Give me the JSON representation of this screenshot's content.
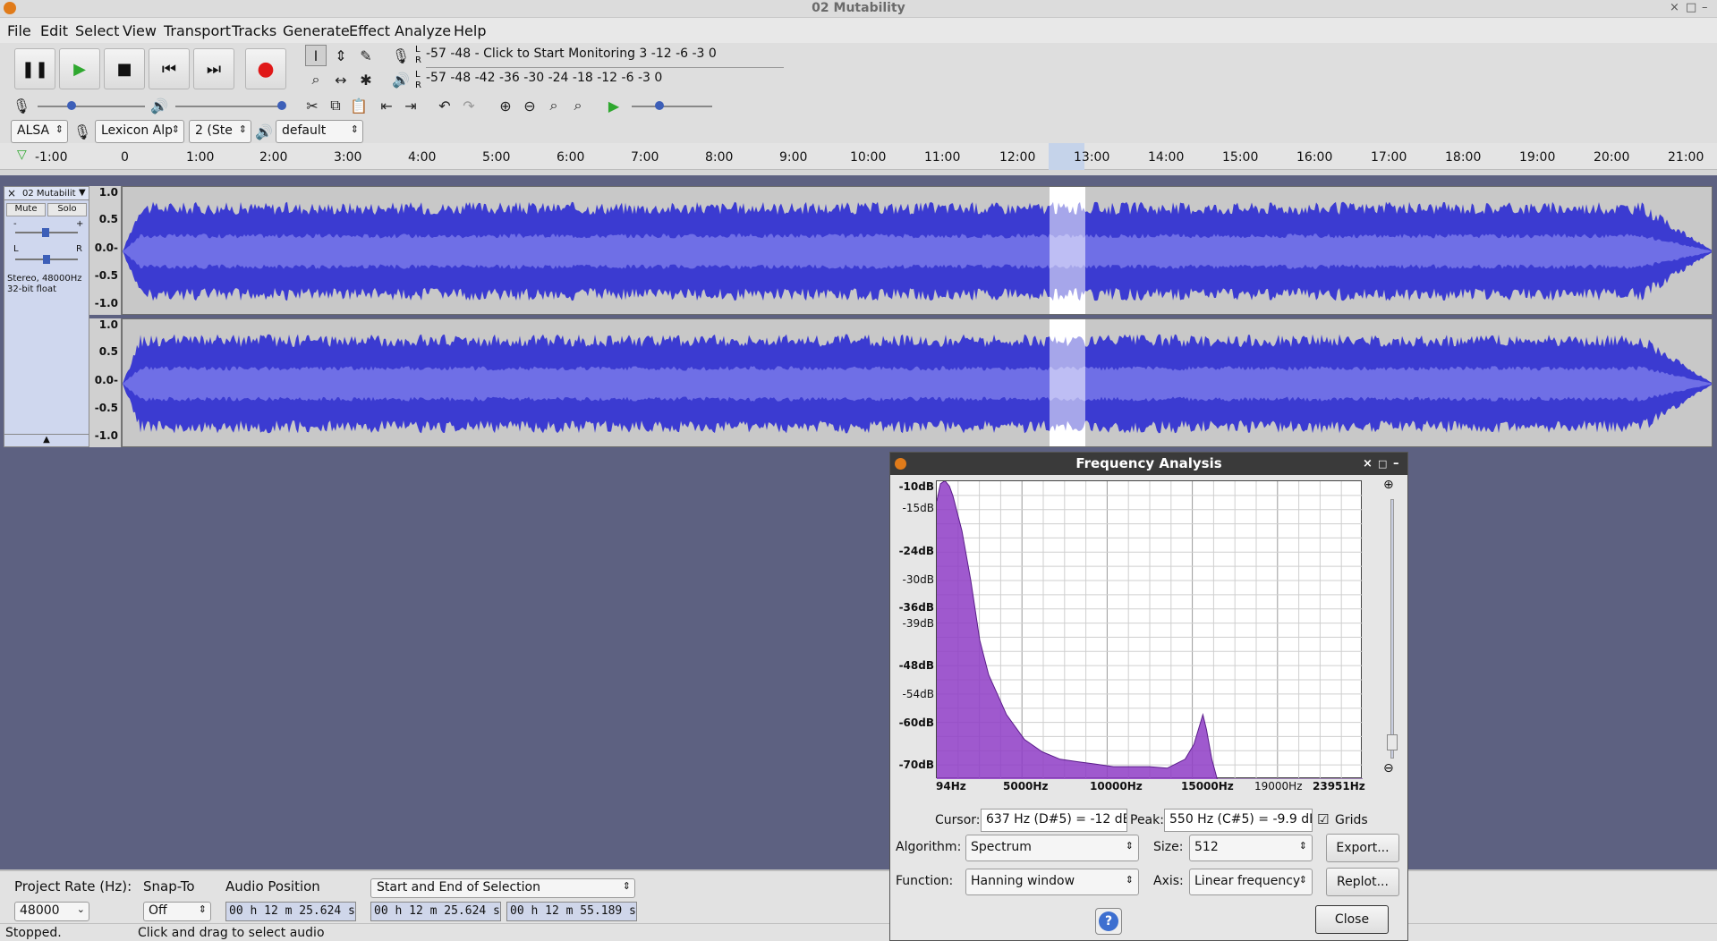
{
  "window": {
    "title": "02 Mutability",
    "controls": {
      "close": "×",
      "maximize": "□",
      "minimize": "–"
    }
  },
  "menu": [
    "File",
    "Edit",
    "Select",
    "View",
    "Transport",
    "Tracks",
    "Generate",
    "Effect",
    "Analyze",
    "Help"
  ],
  "transport": {
    "pause_icon": "pause-icon",
    "play_icon": "play-icon",
    "stop_icon": "stop-icon",
    "skip_start_icon": "skip-start-icon",
    "skip_end_icon": "skip-end-icon",
    "record_icon": "record-icon"
  },
  "meters": {
    "record_ticks": "-57        -48     - Click to Start Monitoring 3     -12       -6  -3  0",
    "record_hint": "Click to Start Monitoring",
    "play_ticks": "-57        -48     -42      -36      -30      -24      -18      -12       -6  -3  0",
    "lr_top": "L",
    "lr_bottom": "R"
  },
  "device": {
    "host": "ALSA",
    "input": "Lexicon Alp",
    "channels": "2 (Ste",
    "output": "default"
  },
  "timeline": [
    "-1:00",
    "0",
    "1:00",
    "2:00",
    "3:00",
    "4:00",
    "5:00",
    "6:00",
    "7:00",
    "8:00",
    "9:00",
    "10:00",
    "11:00",
    "12:00",
    "13:00",
    "14:00",
    "15:00",
    "16:00",
    "17:00",
    "18:00",
    "19:00",
    "20:00",
    "21:00"
  ],
  "track": {
    "name": "02 Mutabilit",
    "close": "×",
    "mute": "Mute",
    "solo": "Solo",
    "gain_minus": "-",
    "gain_plus": "+",
    "pan_l": "L",
    "pan_r": "R",
    "info_line1": "Stereo, 48000Hz",
    "info_line2": "32-bit float",
    "ruler": [
      "1.0",
      "0.5",
      "0.0-",
      "-0.5",
      "-1.0"
    ],
    "color": "#3b3bd1",
    "rms_color": "#6f6fe6",
    "selection_color": "#ffffff"
  },
  "selection_toolbar": {
    "project_rate_label": "Project Rate (Hz):",
    "project_rate": "48000",
    "snap_label": "Snap-To",
    "snap_value": "Off",
    "audio_position_label": "Audio Position",
    "selection_mode": "Start and End of Selection",
    "audio_position": "00 h 12 m 25.624 s",
    "sel_start": "00 h 12 m 25.624 s",
    "sel_end": "00 h 12 m 55.189 s"
  },
  "status": {
    "state": "Stopped.",
    "hint": "Click and drag to select audio"
  },
  "dialog": {
    "title": "Frequency Analysis",
    "controls": {
      "close": "×",
      "maximize": "□",
      "minimize": "–"
    },
    "y_labels": [
      "-10dB",
      "-15dB",
      "-24dB",
      "-30dB",
      "-36dB",
      "-39dB",
      "-48dB",
      "-54dB",
      "-60dB",
      "-70dB"
    ],
    "x_labels": [
      "94Hz",
      "5000Hz",
      "10000Hz",
      "15000Hz",
      "19000Hz",
      "23951Hz"
    ],
    "cursor_label": "Cursor:",
    "cursor_value": "637 Hz (D#5) = -12 dB",
    "peak_label": "Peak:",
    "peak_value": "550 Hz (C#5) = -9.9 dB",
    "grids_label": "Grids",
    "grids_checked": "☑",
    "algorithm_label": "Algorithm:",
    "algorithm": "Spectrum",
    "size_label": "Size:",
    "size": "512",
    "export": "Export...",
    "function_label": "Function:",
    "function": "Hanning window",
    "axis_label": "Axis:",
    "axis": "Linear frequency",
    "replot": "Replot...",
    "help": "?",
    "close_button": "Close",
    "spectrum_color": "#8e3cc6"
  },
  "chart_data": {
    "type": "area",
    "title": "",
    "xlabel": "",
    "ylabel": "",
    "xlim": [
      94,
      23951
    ],
    "ylim": [
      -70,
      -10
    ],
    "grid": true,
    "x": [
      94,
      300,
      550,
      800,
      1000,
      1500,
      2000,
      2500,
      3000,
      3500,
      4000,
      5000,
      6000,
      7000,
      8000,
      9000,
      10000,
      11000,
      12000,
      13000,
      14000,
      14500,
      15000,
      15200,
      15500,
      15800,
      16000,
      17000,
      18000,
      19000,
      20000,
      21000,
      22000,
      23000,
      23951
    ],
    "values": [
      -14,
      -10.5,
      -9.9,
      -11,
      -13,
      -20,
      -30,
      -42,
      -49,
      -53,
      -57,
      -62,
      -64.5,
      -66,
      -66.5,
      -67,
      -67.5,
      -67.5,
      -67.5,
      -67.8,
      -66,
      -63,
      -57,
      -60,
      -66,
      -72,
      -74,
      -75,
      -75,
      -74.5,
      -74,
      -73,
      -72.5,
      -72,
      -71.5
    ]
  }
}
